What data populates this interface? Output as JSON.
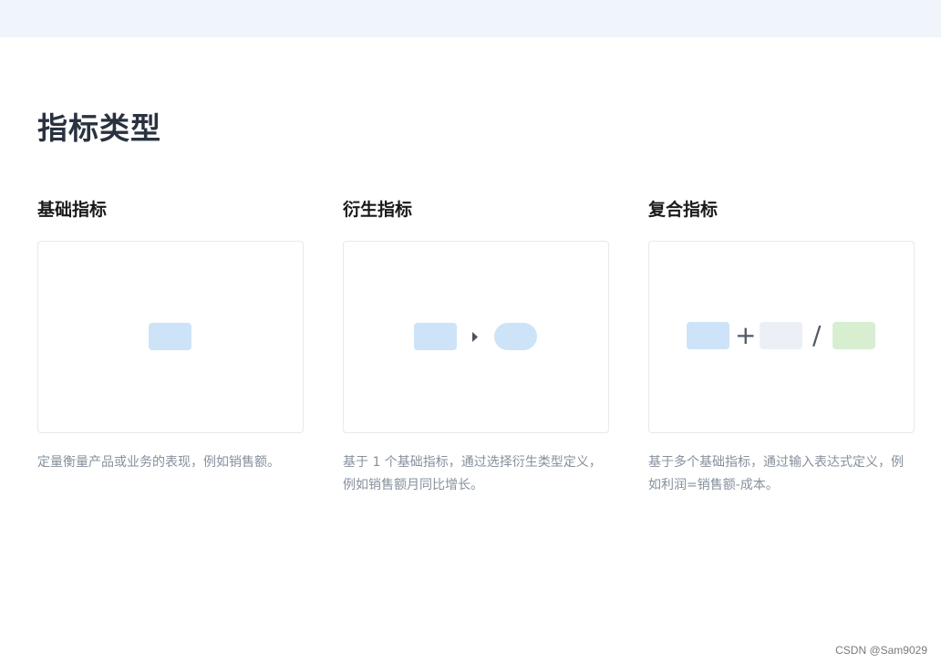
{
  "page": {
    "title": "指标类型"
  },
  "colors": {
    "topbar": "#f0f5fc",
    "block_blue": "#cde3f8",
    "block_gray": "#ebeff6",
    "block_green": "#d7efd0",
    "operator": "#505866"
  },
  "types": [
    {
      "title": "基础指标",
      "description": "定量衡量产品或业务的表现，例如销售额。"
    },
    {
      "title": "衍生指标",
      "description": "基于 1 个基础指标，通过选择衍生类型定义，例如销售额月同比增长。"
    },
    {
      "title": "复合指标",
      "description": "基于多个基础指标，通过输入表达式定义，例如利润=销售额-成本。"
    }
  ],
  "operators": {
    "plus": "+",
    "divide": "/"
  },
  "watermark": "CSDN @Sam9029"
}
